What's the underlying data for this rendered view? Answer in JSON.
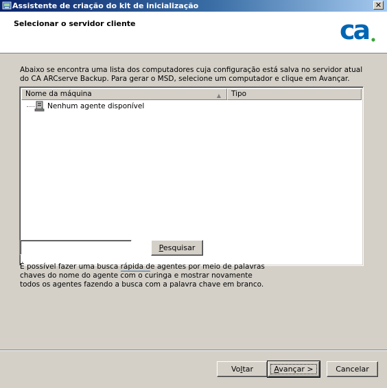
{
  "window": {
    "title": "Assistente de criação do kit de inicialização",
    "close_glyph": "✕"
  },
  "header": {
    "title": "Selecionar o servidor cliente",
    "logo_text": "ca",
    "logo_color": "#0066b3",
    "logo_dot_color": "#3aa537"
  },
  "main": {
    "description": "Abaixo se encontra uma lista dos computadores cuja configuração está salva no servidor atual do CA ARCserve Backup. Para gerar o MSD, selecione um computador e clique em Avançar.",
    "list": {
      "columns": [
        "Nome da máquina",
        "Tipo"
      ],
      "sort_indicator": "▲",
      "items": [
        {
          "label": "Nenhum agente disponível",
          "icon": "server-icon"
        }
      ]
    },
    "search": {
      "value": "",
      "placeholder": "",
      "button_label_pre": "",
      "button_label_accel": "P",
      "button_label_post": "esquisar"
    },
    "hint": {
      "part1": "É possível fazer uma busca ",
      "link": "rápida d",
      "part2": "e agentes por meio de palavras chaves do nome do agente com o curinga e mostrar novamente todos os agentes fazendo a busca com a palavra chave em branco."
    }
  },
  "footer": {
    "back_pre": "Vo",
    "back_accel": "l",
    "back_post": "tar",
    "next_pre": "",
    "next_accel": "A",
    "next_post": "vançar >",
    "cancel": "Cancelar"
  },
  "colors": {
    "titlebar_start": "#0a246a",
    "titlebar_end": "#a6caf0",
    "dialog_bg": "#d4d0c8"
  }
}
